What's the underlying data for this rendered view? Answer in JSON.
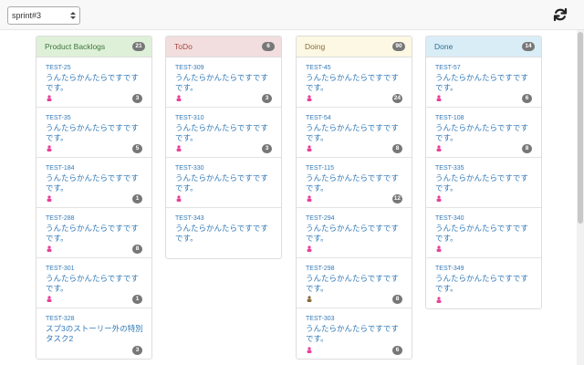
{
  "toolbar": {
    "sprint_selected": "sprint#3",
    "refresh_icon": "refresh-icon"
  },
  "columns": [
    {
      "title": "Product Backlogs",
      "count": "21",
      "header_bg": "#dff0d8",
      "header_color": "#3c763d",
      "cards": [
        {
          "id": "TEST-25",
          "title": "うんたらかんたらですですです。",
          "count": "3",
          "avatar": "pink-user-icon"
        },
        {
          "id": "TEST-35",
          "title": "うんたらかんたらですですです。",
          "count": "5",
          "avatar": "pink-user-icon"
        },
        {
          "id": "TEST-184",
          "title": "うんたらかんたらですですです。",
          "count": "1",
          "avatar": "pink-user-icon"
        },
        {
          "id": "TEST-288",
          "title": "うんたらかんたらですですです。",
          "count": "8",
          "avatar": "pink-user-icon"
        },
        {
          "id": "TEST-301",
          "title": "うんたらかんたらですですです。",
          "count": "1",
          "avatar": "pink-user-icon"
        },
        {
          "id": "TEST-328",
          "title": "スプ3のストーリー外の特別タスク2",
          "count": "3",
          "avatar": ""
        }
      ]
    },
    {
      "title": "ToDo",
      "count": "6",
      "header_bg": "#f2dede",
      "header_color": "#a94442",
      "cards": [
        {
          "id": "TEST-309",
          "title": "うんたらかんたらですですです。",
          "count": "3",
          "avatar": "pink-user-icon"
        },
        {
          "id": "TEST-310",
          "title": "うんたらかんたらですですです。",
          "count": "3",
          "avatar": "pink-user-icon"
        },
        {
          "id": "TEST-330",
          "title": "うんたらかんたらですですです。",
          "count": "",
          "avatar": "pink-user-icon"
        },
        {
          "id": "TEST-343",
          "title": "うんたらかんたらですですです。",
          "count": "",
          "avatar": ""
        }
      ]
    },
    {
      "title": "Doing",
      "count": "90",
      "header_bg": "#fcf8e3",
      "header_color": "#8a6d3b",
      "cards": [
        {
          "id": "TEST-45",
          "title": "うんたらかんたらですですです。",
          "count": "24",
          "avatar": "pink-user-icon"
        },
        {
          "id": "TEST-54",
          "title": "うんたらかんたらですですです。",
          "count": "8",
          "avatar": "pink-user-icon"
        },
        {
          "id": "TEST-115",
          "title": "うんたらかんたらですですです。",
          "count": "12",
          "avatar": "pink-user-icon"
        },
        {
          "id": "TEST-294",
          "title": "うんたらかんたらですですです。",
          "count": "",
          "avatar": "pink-user-icon"
        },
        {
          "id": "TEST-298",
          "title": "うんたらかんたらですですです。",
          "count": "8",
          "avatar": "brown-user-icon"
        },
        {
          "id": "TEST-303",
          "title": "うんたらかんたらですですです。",
          "count": "6",
          "avatar": "pink-user-icon"
        }
      ]
    },
    {
      "title": "Done",
      "count": "14",
      "header_bg": "#d9edf7",
      "header_color": "#31708f",
      "cards": [
        {
          "id": "TEST-57",
          "title": "うんたらかんたらですですです。",
          "count": "6",
          "avatar": "pink-user-icon"
        },
        {
          "id": "TEST-108",
          "title": "うんたらかんたらですですです。",
          "count": "8",
          "avatar": "pink-user-icon"
        },
        {
          "id": "TEST-335",
          "title": "うんたらかんたらですですです。",
          "count": "",
          "avatar": "pink-user-icon"
        },
        {
          "id": "TEST-340",
          "title": "うんたらかんたらですですです。",
          "count": "",
          "avatar": "pink-user-icon"
        },
        {
          "id": "TEST-349",
          "title": "うんたらかんたらですですです。",
          "count": "",
          "avatar": "pink-user-icon"
        }
      ]
    }
  ]
}
